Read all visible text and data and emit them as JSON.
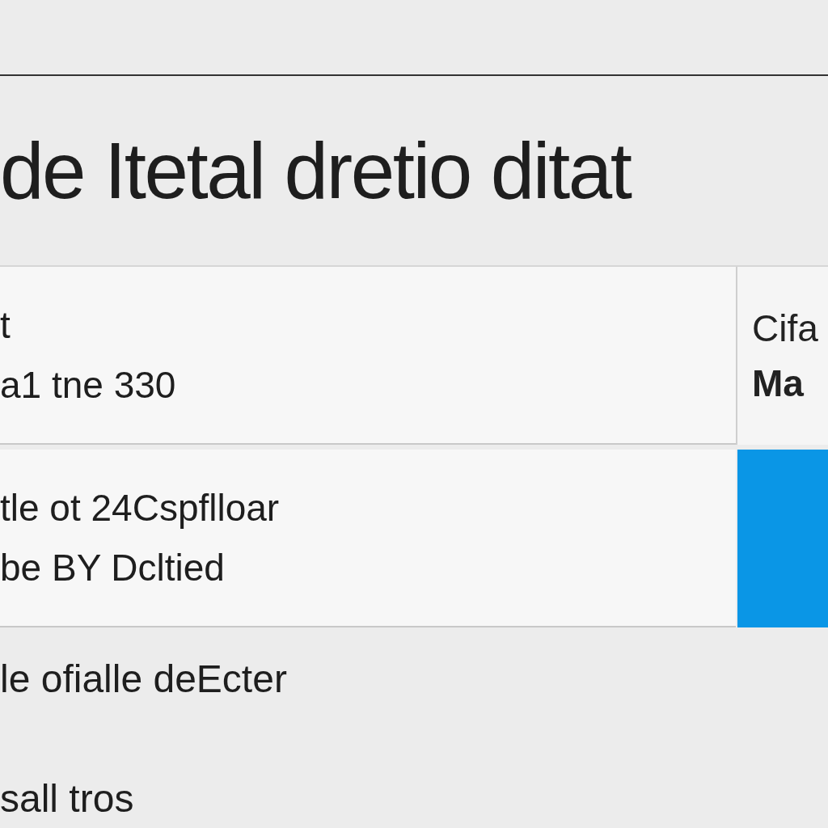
{
  "heading": "de Itetal dretio ditat",
  "cards": [
    {
      "lines": [
        "t",
        "a1 tne 330"
      ],
      "side": {
        "kind": "text",
        "lines": [
          "Cifa",
          "Ma"
        ]
      }
    },
    {
      "lines": [
        "tle ot 24Cspflloar",
        "be BY Dcltied"
      ],
      "side": {
        "kind": "accent"
      }
    }
  ],
  "footer": [
    "le ofialle deEcter",
    "sall tros"
  ]
}
